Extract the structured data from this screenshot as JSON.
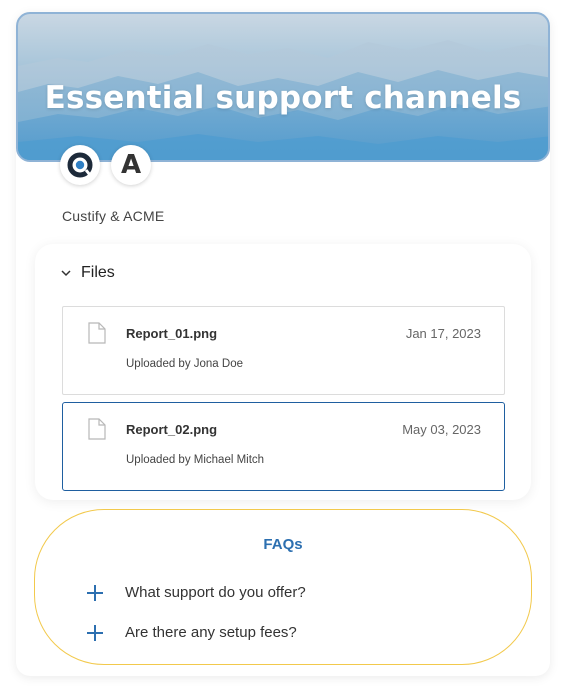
{
  "hero": {
    "title": "Essential support channels"
  },
  "avatars": [
    {
      "name": "Custify",
      "icon": "custify-logo-icon"
    },
    {
      "name": "ACME",
      "letter": "A"
    }
  ],
  "companies_label": "Custify &  ACME",
  "files": {
    "header": "Files",
    "items": [
      {
        "name": "Report_01.png",
        "date": "Jan 17, 2023",
        "uploaded_by": "Uploaded by Jona Doe",
        "selected": false
      },
      {
        "name": "Report_02.png",
        "date": "May 03, 2023",
        "uploaded_by": "Uploaded by Michael Mitch",
        "selected": true
      }
    ]
  },
  "faqs": {
    "title": "FAQs",
    "items": [
      {
        "question": "What support do you offer?"
      },
      {
        "question": "Are there any setup fees?"
      }
    ]
  },
  "colors": {
    "accent_blue": "#2c6fb0",
    "selected_border": "#1f5fa0",
    "faq_border": "#f2c94c"
  }
}
